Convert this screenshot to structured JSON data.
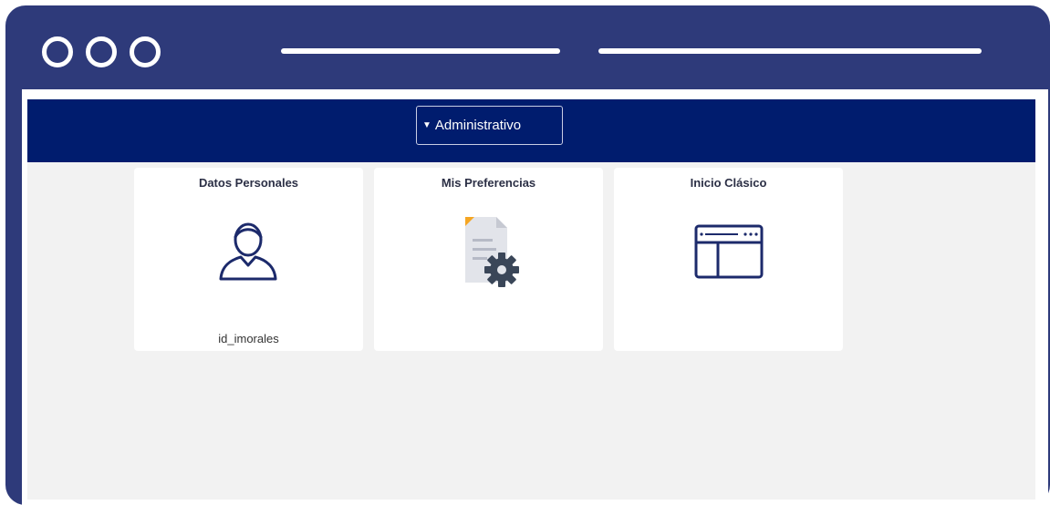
{
  "navbar": {
    "dropdown_label": "Administrativo"
  },
  "tiles": [
    {
      "title": "Datos Personales",
      "subtitle": "id_imorales",
      "icon": "user-profile-icon"
    },
    {
      "title": "Mis Preferencias",
      "icon": "document-gear-icon"
    },
    {
      "title": "Inicio Clásico",
      "icon": "browser-window-icon"
    }
  ],
  "colors": {
    "frame": "#2e3a7a",
    "navbar": "#001c6e",
    "content_bg": "#f2f2f2",
    "icon_stroke": "#1c2a6b"
  }
}
